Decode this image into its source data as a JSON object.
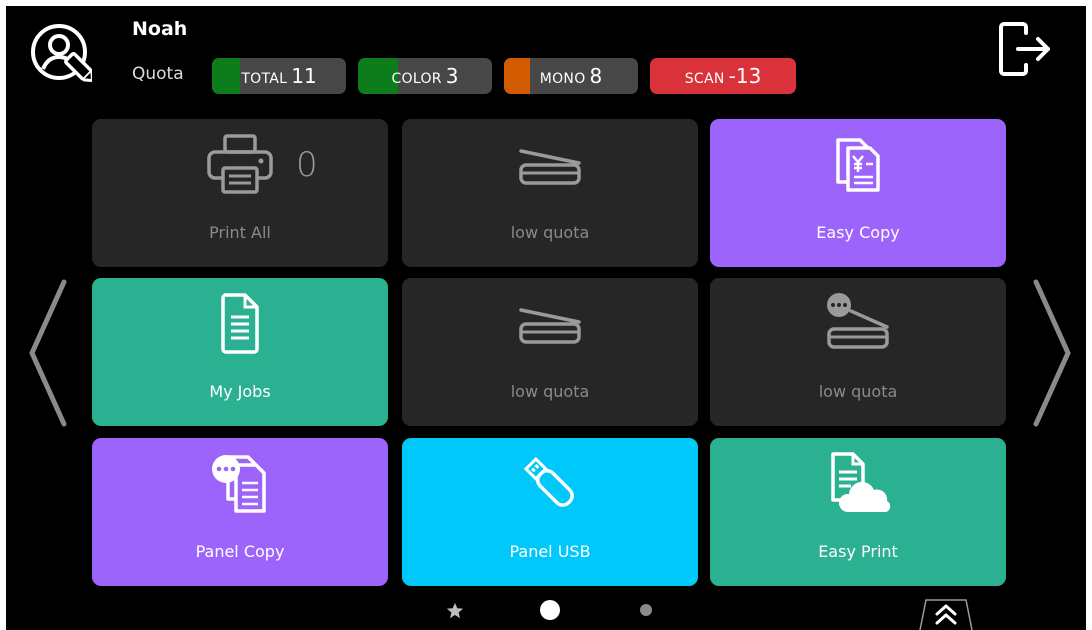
{
  "user": {
    "name": "Noah"
  },
  "quota": {
    "label": "Quota",
    "total": {
      "label": "TOTAL",
      "value": "11"
    },
    "color": {
      "label": "COLOR",
      "value": "3"
    },
    "mono": {
      "label": "MONO",
      "value": "8"
    },
    "scan": {
      "label": "SCAN",
      "value": "-13"
    }
  },
  "colors": {
    "accent_green": "#0d7d1c",
    "accent_orange": "#d25a00",
    "scan_red": "#d9323a",
    "tile_purple": "#9d64fb",
    "tile_green": "#2bb091",
    "tile_cyan": "#00c8fa",
    "tile_dark": "#262626"
  },
  "tiles": [
    {
      "label": "Print All",
      "count": "0",
      "icon": "printer-icon"
    },
    {
      "label": "low quota",
      "icon": "scanner-icon"
    },
    {
      "label": "Easy Copy",
      "icon": "copy-document-icon"
    },
    {
      "label": "My Jobs",
      "icon": "document-icon"
    },
    {
      "label": "low quota",
      "icon": "scanner-icon"
    },
    {
      "label": "low quota",
      "icon": "scanner-more-icon"
    },
    {
      "label": "Panel Copy",
      "icon": "copy-more-icon"
    },
    {
      "label": "Panel USB",
      "icon": "usb-icon"
    },
    {
      "label": "Easy Print",
      "icon": "cloud-print-icon"
    }
  ],
  "pagination": {
    "pages": 3,
    "current": 2,
    "first_icon": "star-icon"
  }
}
